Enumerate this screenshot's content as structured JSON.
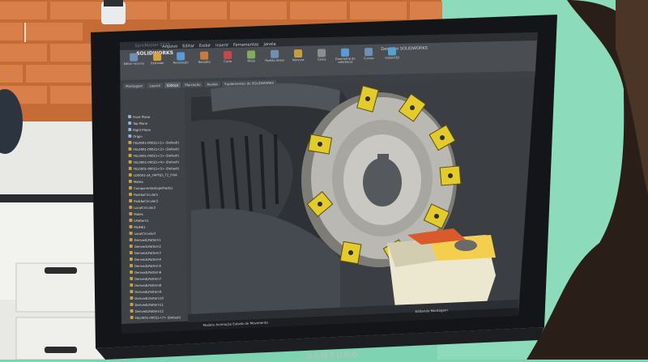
{
  "monitor": {
    "brand": "SAMSUNG",
    "model": "SyncMaster 2233"
  },
  "app": {
    "logo_text": "SOLIDWORKS",
    "menu_items": [
      "Arquivo",
      "Editar",
      "Exibir",
      "Inserir",
      "Ferramentas",
      "Janela"
    ],
    "document_name": "Desenho SOLIDWORKS",
    "ribbon": [
      {
        "label": "Editar recurso"
      },
      {
        "label": "Extrusão"
      },
      {
        "label": "Revolução"
      },
      {
        "label": "Ressalto"
      },
      {
        "label": "Corte"
      },
      {
        "label": "Filete"
      },
      {
        "label": "Padrão linear"
      },
      {
        "label": "Nervura"
      },
      {
        "label": "Casca"
      },
      {
        "label": "Geometria de referência"
      },
      {
        "label": "Curvas"
      },
      {
        "label": "Instant3D"
      }
    ],
    "tabs": [
      {
        "label": "Montagem",
        "active": false
      },
      {
        "label": "Layout",
        "active": false
      },
      {
        "label": "Esboço",
        "active": true
      },
      {
        "label": "Marcação",
        "active": false
      },
      {
        "label": "Avaliar",
        "active": false
      },
      {
        "label": "Suplementos do SOLIDWORKS",
        "active": false
      }
    ],
    "tree_items": [
      "Front Plane",
      "Top Plane",
      "Right Plane",
      "Origin",
      "FEL0001-00021<1> (Default)",
      "FEL0001-00021<2> (Default)",
      "FEL0001-00021<3> (Default)",
      "FEL0001-00021<4> (Default)",
      "FEL0001-00021<5> (Default)",
      "LD0001-14_TAPTE5_T2_FIXA",
      "Matea",
      "ComponentesEspelhado1",
      "PadrãoCircular1",
      "PadrãoCircular2",
      "LocalCircular2",
      "Mates",
      "LPattern1",
      "MLINE1",
      "LocalCircular3",
      "DerivedLPattern1",
      "DerivedLPattern2",
      "DerivedLPattern3",
      "DerivedLPattern4",
      "DerivedLPattern5",
      "DerivedLPattern6",
      "DerivedLPattern7",
      "DerivedLPattern8",
      "DerivedLPattern9",
      "DerivedLPattern10",
      "DerivedLPattern11",
      "DerivedLPattern12",
      "FEL0001-00021<7> (Default)"
    ],
    "status_tabs": "Modelo  Animação  Estudo de Movimento",
    "status_text": "Editando Montagem"
  },
  "colors": {
    "wall": "#7ed3b2",
    "brick": "#c9652a",
    "bezel": "#141518",
    "part_body": "#b9b8b2",
    "insert_yellow": "#e3cb2b",
    "holder": "#ece8cf"
  }
}
